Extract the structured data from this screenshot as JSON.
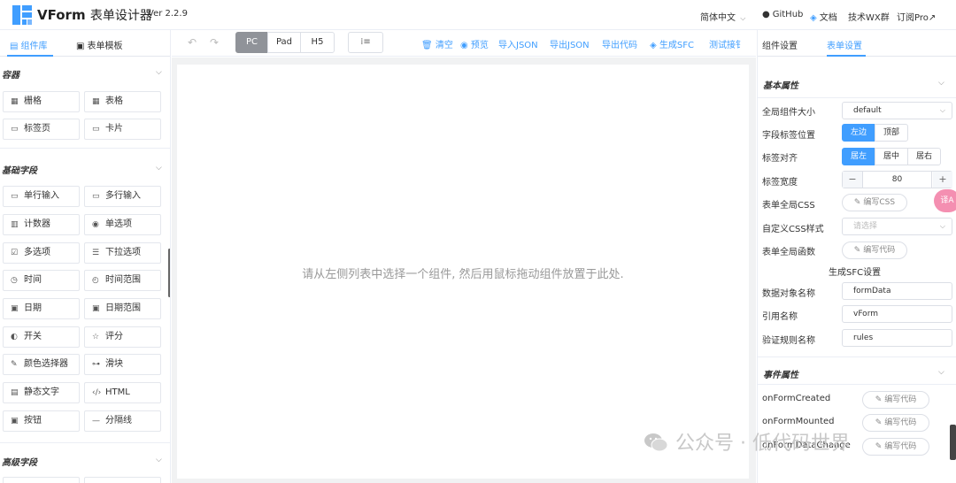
{
  "header": {
    "app_name": "VForm",
    "app_subtitle": "表单设计器",
    "version": "Ver 2.2.9",
    "links": {
      "language": "简体中文",
      "github": "GitHub",
      "docs": "文档",
      "wx_group": "技术WX群",
      "subscribe": "订阅Pro↗"
    }
  },
  "left_panel": {
    "tabs": {
      "components": "组件库",
      "templates": "表单模板"
    },
    "sections": {
      "container": {
        "title": "容器",
        "items": [
          "栅格",
          "表格",
          "标签页",
          "卡片"
        ]
      },
      "basic": {
        "title": "基础字段",
        "items": [
          "单行输入",
          "多行输入",
          "计数器",
          "单选项",
          "多选项",
          "下拉选项",
          "时间",
          "时间范围",
          "日期",
          "日期范围",
          "开关",
          "评分",
          "颜色选择器",
          "滑块",
          "静态文字",
          "HTML",
          "按钮",
          "分隔线"
        ]
      },
      "advanced": {
        "title": "高级字段"
      }
    }
  },
  "toolbar": {
    "devices": [
      "PC",
      "Pad",
      "H5"
    ],
    "active_device": "PC",
    "actions": {
      "clear": "清空",
      "preview": "预览",
      "import_json": "导入JSON",
      "export_json": "导出JSON",
      "export_code": "导出代码",
      "generate_sfc": "生成SFC",
      "test_api": "测试接钅"
    }
  },
  "canvas": {
    "hint": "请从左侧列表中选择一个组件, 然后用鼠标拖动组件放置于此处."
  },
  "right_panel": {
    "tabs": {
      "component_settings": "组件设置",
      "form_settings": "表单设置"
    },
    "basic_props": {
      "title": "基本属性",
      "size_label": "全局组件大小",
      "size_value": "default",
      "label_position_label": "字段标签位置",
      "label_position_options": [
        "左边",
        "顶部"
      ],
      "label_align_label": "标签对齐",
      "label_align_options": [
        "居左",
        "居中",
        "居右"
      ],
      "label_width_label": "标签宽度",
      "label_width_value": "80",
      "form_css_label": "表单全局CSS",
      "edit_css_btn": "编写CSS",
      "custom_class_label": "自定义CSS样式",
      "custom_class_placeholder": "请选择",
      "form_functions_label": "表单全局函数",
      "edit_code_btn": "编写代码"
    },
    "sfc": {
      "title": "生成SFC设置",
      "data_name_label": "数据对象名称",
      "data_name_value": "formData",
      "ref_name_label": "引用名称",
      "ref_name_value": "vForm",
      "rules_name_label": "验证规则名称",
      "rules_name_value": "rules"
    },
    "events": {
      "title": "事件属性",
      "items": [
        {
          "label": "onFormCreated",
          "btn": "编写代码"
        },
        {
          "label": "onFormMounted",
          "btn": "编写代码"
        },
        {
          "label": "onFormDataChange",
          "btn": "编写代码"
        }
      ]
    }
  },
  "overlay": {
    "translate_badge": "译A",
    "watermark": "公众号 · 低代码世界"
  },
  "colors": {
    "accent": "#409eff",
    "device_active": "#909399",
    "canvas_bg": "#f1f2f3"
  }
}
